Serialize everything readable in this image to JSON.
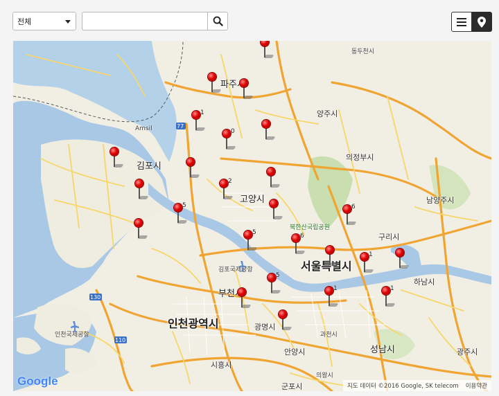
{
  "toolbar": {
    "filter": {
      "selected": "전체"
    },
    "search": {
      "value": "",
      "placeholder": ""
    },
    "search_icon": "search-icon",
    "view_list_icon": "list-icon",
    "view_map_icon": "map-marker-icon"
  },
  "map": {
    "labels": {
      "paju": "파주시",
      "dongducheon": "동두천시",
      "yangju": "양주시",
      "uijeongbu": "의정부시",
      "gimpo": "김포시",
      "goyang": "고양시",
      "namyangju": "남양주시",
      "bukhansan": "북한산국립공원",
      "guri": "구리시",
      "seoul": "서울특별시",
      "hanam": "하남시",
      "gimpo_airport": "김포국제공항",
      "bucheon": "부천시",
      "incheon": "인천광역시",
      "gwangmyeong": "광명시",
      "gwacheon": "과천시",
      "incheon_airport": "인천국제공항",
      "seongnam": "성남시",
      "gwangju": "광주시",
      "anyang": "안양시",
      "siheung": "시흥시",
      "uiwang": "의왕시",
      "gunpo": "군포시",
      "amsil": "Amsil",
      "route77": "77",
      "route130": "130",
      "route110": "110"
    },
    "pin_numbers": [
      "1",
      "0",
      "2",
      "5",
      "5",
      "6",
      "6",
      "1",
      "5",
      "1",
      "1",
      "1",
      "1"
    ],
    "attribution": {
      "data": "지도 데이터 ©2016 Google, SK telecom",
      "terms": "이용약관"
    },
    "logo": "Google"
  }
}
